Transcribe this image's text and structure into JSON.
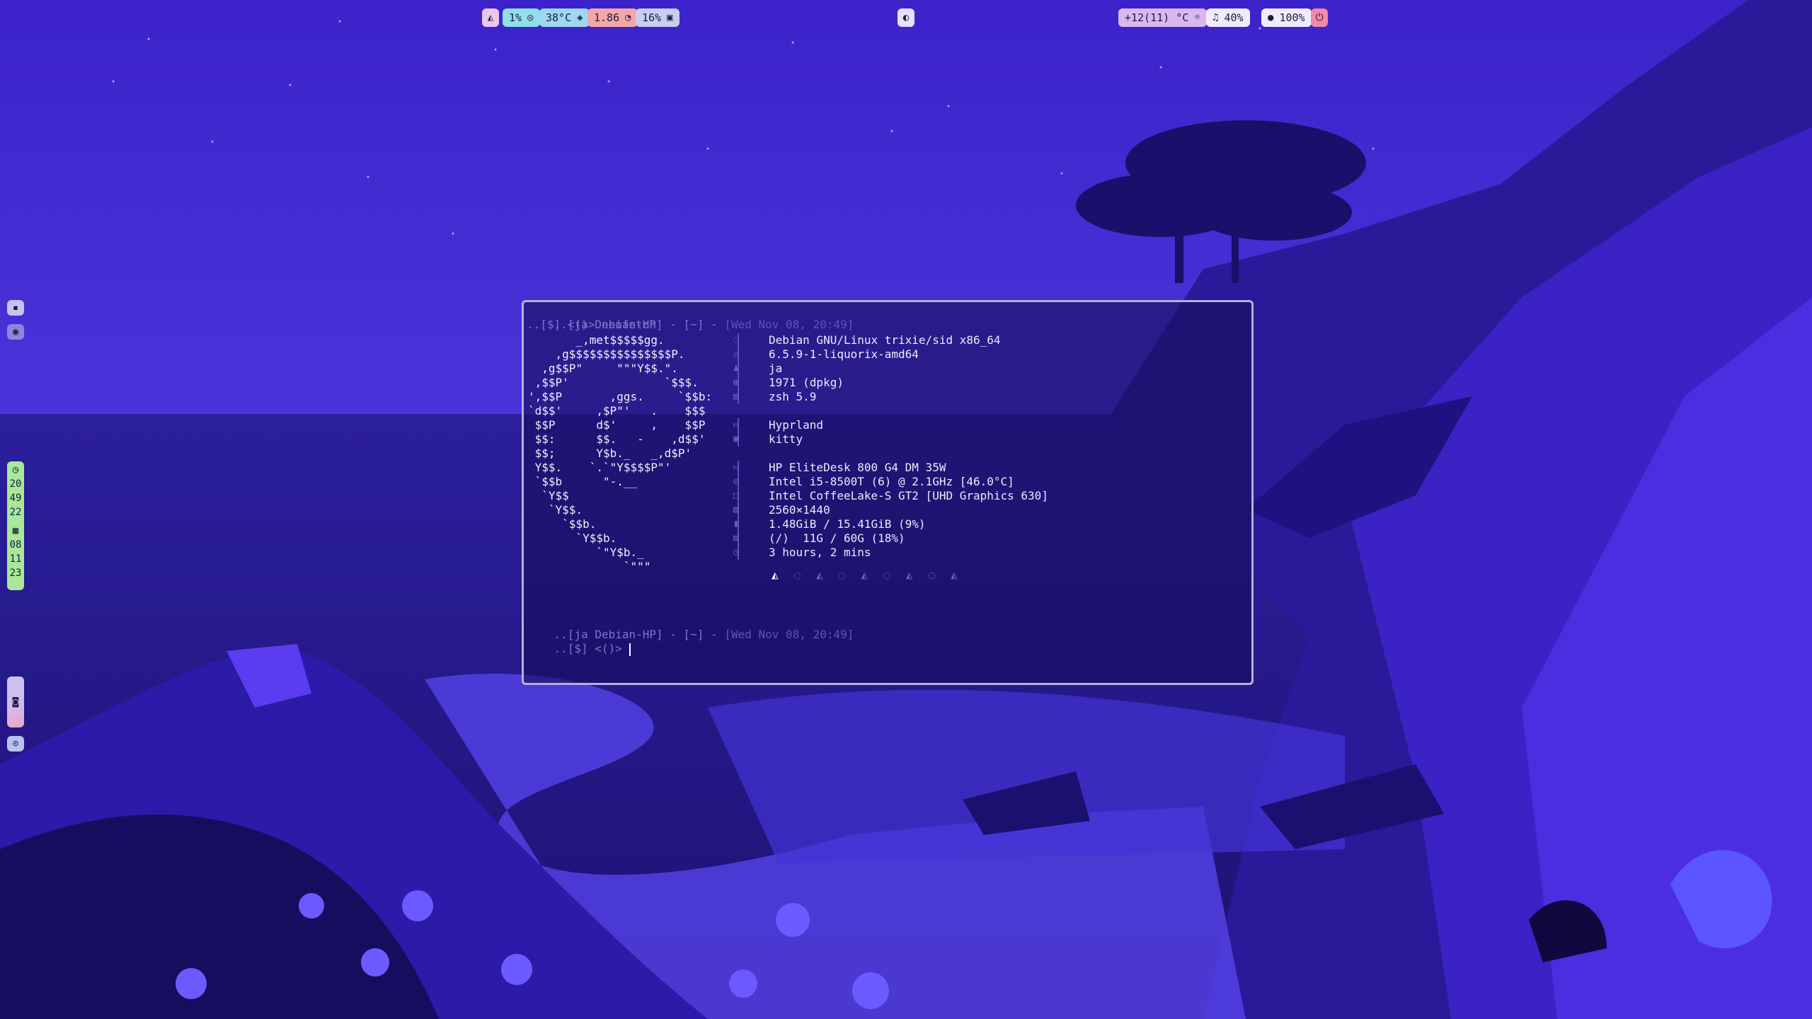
{
  "topbar": {
    "left": [
      {
        "icon": "linux-icon",
        "text": "",
        "color": "#e9c8ee"
      },
      {
        "icon": "cpu-icon",
        "text": "1%",
        "color": "#8fe0e8"
      },
      {
        "icon": "thermometer-icon",
        "text": "38°C",
        "color": "#9cd8f0"
      },
      {
        "icon": "load-icon",
        "text": "1.86",
        "color": "#f4a7a7"
      },
      {
        "icon": "disk-icon",
        "text": "16%",
        "color": "#c6cff0"
      }
    ],
    "center_icon": "hyprland-icon",
    "right": [
      {
        "icon": "weather-icon",
        "text": "+12(11) °C",
        "color": "#d9b8ef"
      },
      {
        "icon": "headphone-icon",
        "text": "40%",
        "color": "#f2ebff"
      },
      {
        "icon": "mic-icon",
        "text": "100%",
        "color": "#f2ebff"
      },
      {
        "icon": "power-icon",
        "text": "",
        "color": "#f08aa8"
      }
    ]
  },
  "sidebar": {
    "clock_hours": "20",
    "clock_minutes": "49",
    "clock_seconds": "22",
    "date_day": "08",
    "date_month": "11",
    "date_year": "23"
  },
  "terminal": {
    "prompt1_user": "..[ja Debian-HP] - [~] - ",
    "prompt1_date": "[Wed Nov 08, 20:49]",
    "prompt1_cmd": "..[$] <()> neofetch",
    "logo": "       _,met$$$$$gg.\n    ,g$$$$$$$$$$$$$$$P.\n  ,g$$P\"     \"\"\"Y$$.\".\n ,$$P'              `$$$.\n',$$P       ,ggs.     `$$b:\n`d$$'     ,$P\"'   .    $$$\n $$P      d$'     ,    $$P\n $$:      $$.   -    ,d$$'\n $$;      Y$b._   _,d$P'\n Y$$.    `.`\"Y$$$$P\"'\n `$$b      \"-.__\n  `Y$$\n   `Y$$.\n     `$$b.\n       `Y$$b.\n          `\"Y$b._\n              `\"\"\"",
    "info": [
      {
        "icon": "os-icon",
        "text": "Debian GNU/Linux trixie/sid x86_64"
      },
      {
        "icon": "kernel-icon",
        "text": "6.5.9-1-liquorix-amd64"
      },
      {
        "icon": "user-icon",
        "text": "ja"
      },
      {
        "icon": "package-icon",
        "text": "1971 (dpkg)"
      },
      {
        "icon": "shell-icon",
        "text": "zsh 5.9"
      },
      {
        "icon": "wm-icon",
        "text": "Hyprland"
      },
      {
        "icon": "terminal-icon",
        "text": "kitty"
      },
      {
        "icon": "host-icon",
        "text": "HP EliteDesk 800 G4 DM 35W"
      },
      {
        "icon": "cpu-icon",
        "text": "Intel i5-8500T (6) @ 2.1GHz [46.0°C]"
      },
      {
        "icon": "gpu-icon",
        "text": "Intel CoffeeLake-S GT2 [UHD Graphics 630]"
      },
      {
        "icon": "resolution-icon",
        "text": "2560×1440"
      },
      {
        "icon": "memory-icon",
        "text": "1.48GiB / 15.41GiB (9%)"
      },
      {
        "icon": "disk-icon",
        "text": "(/)  11G / 60G (18%)"
      },
      {
        "icon": "uptime-icon",
        "text": "3 hours, 2 mins"
      }
    ],
    "prompt2_user": "..[ja Debian-HP] - [~] - ",
    "prompt2_date": "[Wed Nov 08, 20:49]",
    "prompt2_cmd": "..[$] <()> "
  }
}
